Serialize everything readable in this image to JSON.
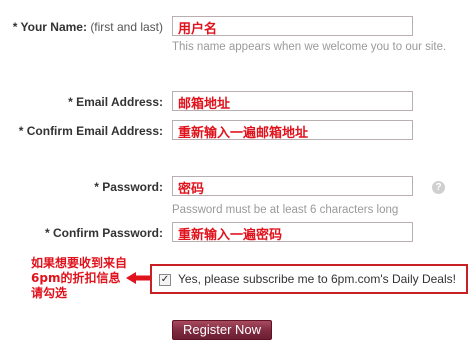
{
  "form": {
    "name": {
      "label": "* Your Name:",
      "sublabel": "(first and last)",
      "value": "用户名",
      "hint": "This name appears when we welcome you to our site."
    },
    "email": {
      "label": "* Email Address:",
      "value": "邮箱地址"
    },
    "confirm_email": {
      "label": "* Confirm Email Address:",
      "value": "重新输入一遍邮箱地址"
    },
    "password": {
      "label": "* Password:",
      "value": "密码",
      "hint": "Password must be at least 6 characters long",
      "help_icon": "?"
    },
    "confirm_password": {
      "label": "* Confirm Password:",
      "value": "重新输入一遍密码"
    },
    "subscribe": {
      "checked": true,
      "check_mark": "✓",
      "label": "Yes, please subscribe me to 6pm.com's Daily Deals!"
    },
    "register_label": "Register Now"
  },
  "annotation": {
    "lines": [
      "如果想要收到来自",
      "6pm的折扣信息",
      "请勾选"
    ]
  },
  "colors": {
    "annotation_red": "#e0121c",
    "highlight_border": "#c82025",
    "button_bg": "#7e2a3f",
    "hint_gray": "#9a9a9a"
  }
}
